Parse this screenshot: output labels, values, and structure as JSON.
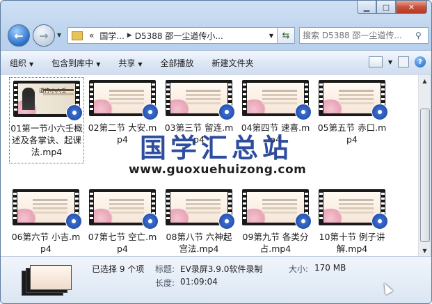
{
  "address": {
    "prefix": "«",
    "segments": [
      "国学...",
      "D5388 邵一尘道传小..."
    ]
  },
  "search": {
    "placeholder": "搜索 D5388 邵一尘道传..."
  },
  "toolbar": {
    "organize": "组织",
    "include_library": "包含到库中",
    "share": "共享",
    "play_all": "全部播放",
    "new_folder": "新建文件夹"
  },
  "files": [
    {
      "name": "01第一节小六壬概述及各掌诀、起课法.mp4",
      "selected": true
    },
    {
      "name": "02第二节 大安.mp4"
    },
    {
      "name": "03第三节 留连.mp4"
    },
    {
      "name": "04第四节 速喜.mp4"
    },
    {
      "name": "05第五节 赤口.mp4"
    },
    {
      "name": "06第六节 小吉.mp4"
    },
    {
      "name": "07第七节 空亡.mp4"
    },
    {
      "name": "08第八节 六神起宫法.mp4"
    },
    {
      "name": "09第九节 各类分占.mp4"
    },
    {
      "name": "10第十节 例子讲解.mp4"
    }
  ],
  "thumb1_text": "道传小六壬",
  "watermark": {
    "title": "国学汇总站",
    "url": "www.guoxuehuizong.com"
  },
  "details": {
    "selected_count": "已选择 9 个项",
    "title_label": "标题:",
    "title_value": "EV录屏3.9.0软件录制",
    "length_label": "长度:",
    "length_value": "01:09:04",
    "size_label": "大小:",
    "size_value": "170 MB"
  },
  "colors": {
    "watermark": "#1e3e96",
    "close_button": "#c8523b"
  }
}
